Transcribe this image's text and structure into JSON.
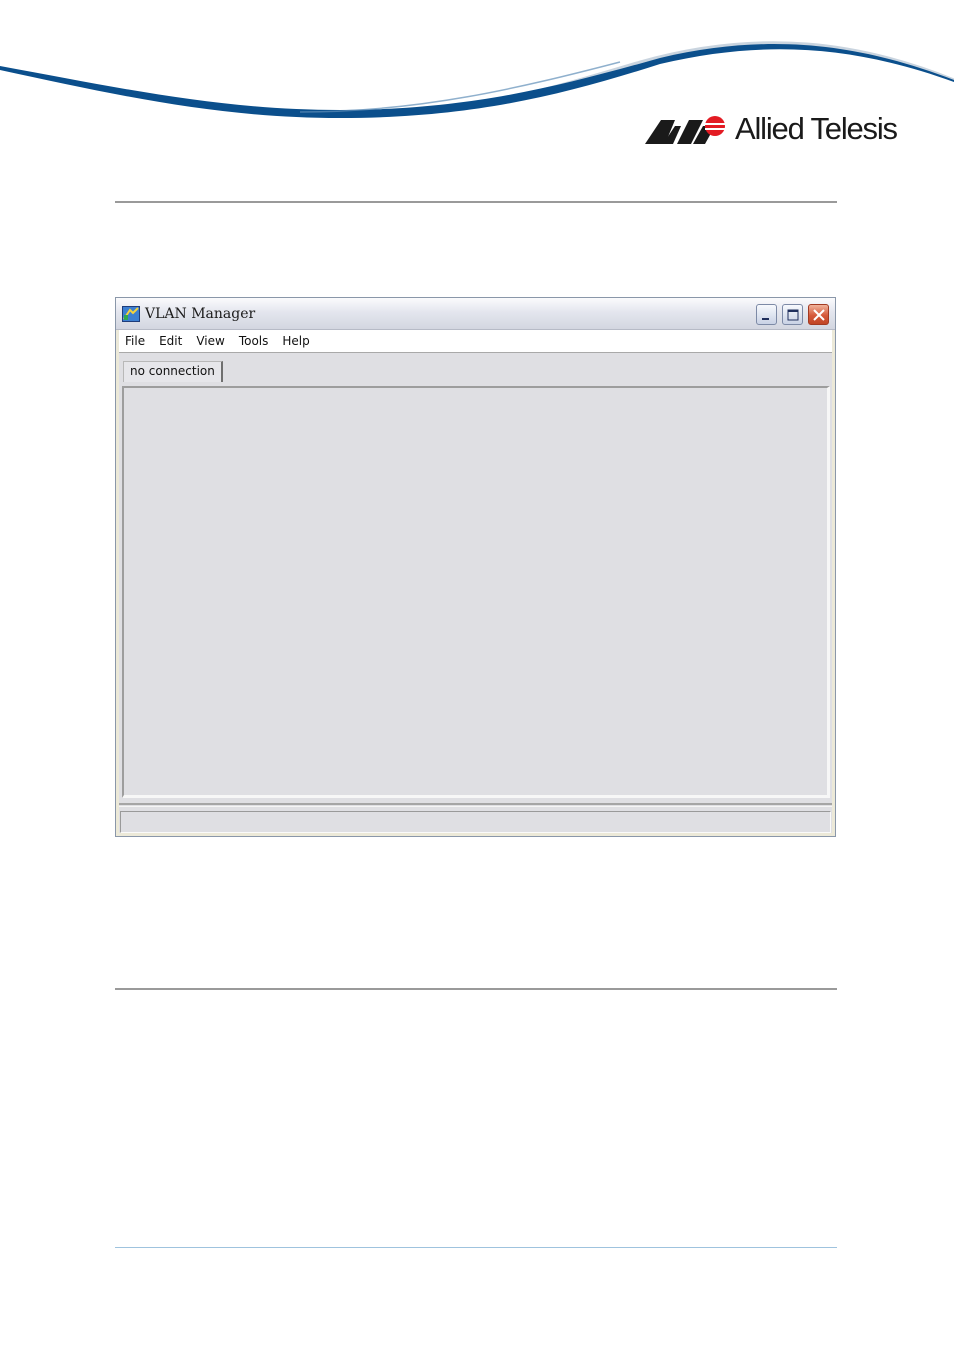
{
  "brand": {
    "name": "Allied Telesis",
    "accent_color": "#004b87",
    "logo_red": "#e31b23"
  },
  "window": {
    "title": "VLAN Manager",
    "app_icon": "vlan-manager-icon",
    "controls": [
      "minimize-icon",
      "maximize-icon",
      "close-icon"
    ],
    "menu": [
      "File",
      "Edit",
      "View",
      "Tools",
      "Help"
    ],
    "tabs": [
      {
        "label": "no connection"
      }
    ],
    "status_text": ""
  }
}
